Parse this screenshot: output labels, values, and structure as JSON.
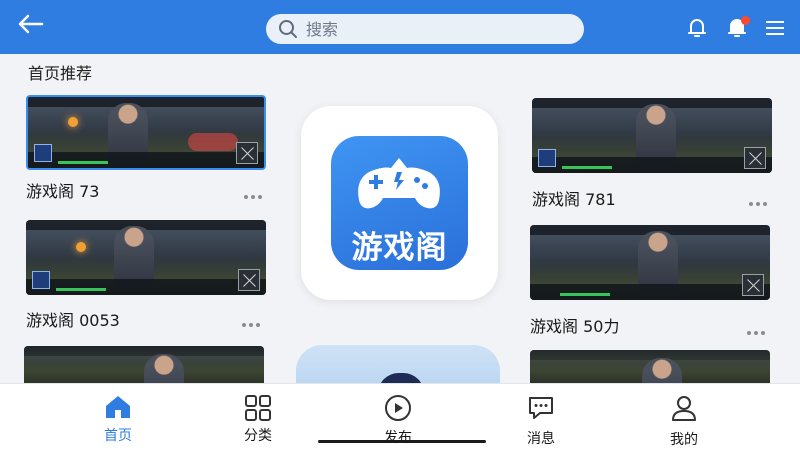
{
  "header": {
    "back_icon": "back-arrow-icon",
    "search_placeholder": "搜索",
    "icons": [
      "bell-icon",
      "notification-icon",
      "menu-icon"
    ],
    "accent_color": "#2f7de1",
    "badge_color": "#ff4a2c"
  },
  "section": {
    "title": "首页推荐"
  },
  "cards": [
    {
      "title": "游戏阁 73",
      "selected": true
    },
    {
      "title": "游戏阁 0053",
      "selected": false
    },
    {
      "title": "游戏阁 781",
      "selected": false
    },
    {
      "title": "游戏阁 50力",
      "selected": false
    }
  ],
  "featured_app": {
    "label": "游戏阁",
    "icon": "gamepad-icon"
  },
  "bottom_nav": {
    "items": [
      {
        "label": "首页",
        "icon": "home-icon",
        "active": true
      },
      {
        "label": "分类",
        "icon": "grid-icon",
        "active": false
      },
      {
        "label": "发布",
        "icon": "play-icon",
        "active": false
      },
      {
        "label": "消息",
        "icon": "message-icon",
        "active": false
      },
      {
        "label": "我的",
        "icon": "user-icon",
        "active": false
      }
    ]
  }
}
